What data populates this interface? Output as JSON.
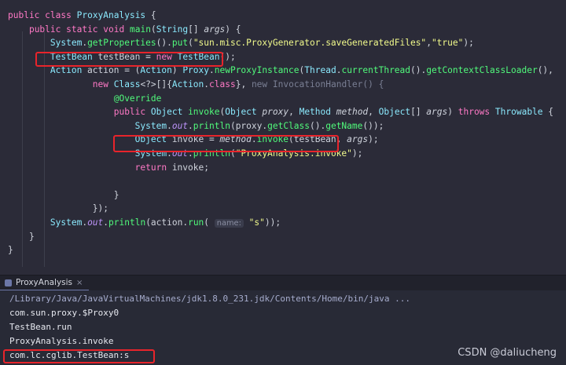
{
  "editor": {
    "lines": [
      {
        "segments": [
          {
            "t": "public",
            "c": "kw"
          },
          {
            "t": " "
          },
          {
            "t": "class",
            "c": "kw"
          },
          {
            "t": " "
          },
          {
            "t": "ProxyAnalysis",
            "c": "cls"
          },
          {
            "t": " {"
          }
        ]
      },
      {
        "segments": [
          {
            "t": "    "
          },
          {
            "t": "public",
            "c": "kw"
          },
          {
            "t": " "
          },
          {
            "t": "static",
            "c": "kw"
          },
          {
            "t": " "
          },
          {
            "t": "void",
            "c": "kw"
          },
          {
            "t": " "
          },
          {
            "t": "main",
            "c": "fn"
          },
          {
            "t": "("
          },
          {
            "t": "String",
            "c": "cls"
          },
          {
            "t": "[] "
          },
          {
            "t": "args",
            "c": "param"
          },
          {
            "t": ") {"
          }
        ]
      },
      {
        "segments": [
          {
            "t": "        "
          },
          {
            "t": "System",
            "c": "cls"
          },
          {
            "t": "."
          },
          {
            "t": "getProperties",
            "c": "fn"
          },
          {
            "t": "()."
          },
          {
            "t": "put",
            "c": "fn"
          },
          {
            "t": "("
          },
          {
            "t": "\"sun.misc.ProxyGenerator.saveGeneratedFiles\"",
            "c": "str"
          },
          {
            "t": ","
          },
          {
            "t": "\"true\"",
            "c": "str"
          },
          {
            "t": ");"
          }
        ]
      },
      {
        "segments": [
          {
            "t": "        "
          },
          {
            "t": "TestBean",
            "c": "cls"
          },
          {
            "t": " testBean = "
          },
          {
            "t": "new",
            "c": "kw"
          },
          {
            "t": " "
          },
          {
            "t": "TestBean",
            "c": "cls"
          },
          {
            "t": "();"
          }
        ]
      },
      {
        "segments": [
          {
            "t": "        "
          },
          {
            "t": "Action",
            "c": "cls"
          },
          {
            "t": " action = ("
          },
          {
            "t": "Action",
            "c": "cls"
          },
          {
            "t": ") "
          },
          {
            "t": "Proxy",
            "c": "cls"
          },
          {
            "t": "."
          },
          {
            "t": "newProxyInstance",
            "c": "fn"
          },
          {
            "t": "("
          },
          {
            "t": "Thread",
            "c": "cls"
          },
          {
            "t": "."
          },
          {
            "t": "currentThread",
            "c": "fn"
          },
          {
            "t": "()."
          },
          {
            "t": "getContextClassLoader",
            "c": "fn"
          },
          {
            "t": "(),"
          }
        ]
      },
      {
        "segments": [
          {
            "t": "                "
          },
          {
            "t": "new",
            "c": "kw"
          },
          {
            "t": " "
          },
          {
            "t": "Class",
            "c": "cls"
          },
          {
            "t": "<?>[]{"
          },
          {
            "t": "Action",
            "c": "cls"
          },
          {
            "t": "."
          },
          {
            "t": "class",
            "c": "kw"
          },
          {
            "t": "}, "
          },
          {
            "t": "new InvocationHandler() {",
            "c": "dim"
          }
        ]
      },
      {
        "segments": [
          {
            "t": "                    "
          },
          {
            "t": "@Override",
            "c": "ann"
          }
        ]
      },
      {
        "segments": [
          {
            "t": "                    "
          },
          {
            "t": "public",
            "c": "kw"
          },
          {
            "t": " "
          },
          {
            "t": "Object",
            "c": "cls"
          },
          {
            "t": " "
          },
          {
            "t": "invoke",
            "c": "fn"
          },
          {
            "t": "("
          },
          {
            "t": "Object",
            "c": "cls"
          },
          {
            "t": " "
          },
          {
            "t": "proxy",
            "c": "param"
          },
          {
            "t": ", "
          },
          {
            "t": "Method",
            "c": "cls"
          },
          {
            "t": " "
          },
          {
            "t": "method",
            "c": "param"
          },
          {
            "t": ", "
          },
          {
            "t": "Object",
            "c": "cls"
          },
          {
            "t": "[] "
          },
          {
            "t": "args",
            "c": "param"
          },
          {
            "t": ") "
          },
          {
            "t": "throws",
            "c": "kw"
          },
          {
            "t": " "
          },
          {
            "t": "Throwable",
            "c": "cls"
          },
          {
            "t": " {"
          }
        ]
      },
      {
        "segments": [
          {
            "t": "                        "
          },
          {
            "t": "System",
            "c": "cls"
          },
          {
            "t": "."
          },
          {
            "t": "out",
            "c": "field"
          },
          {
            "t": "."
          },
          {
            "t": "println",
            "c": "fn"
          },
          {
            "t": "(proxy."
          },
          {
            "t": "getClass",
            "c": "fn"
          },
          {
            "t": "()."
          },
          {
            "t": "getName",
            "c": "fn"
          },
          {
            "t": "());"
          }
        ]
      },
      {
        "segments": [
          {
            "t": "                        "
          },
          {
            "t": "Object",
            "c": "cls"
          },
          {
            "t": " invoke = "
          },
          {
            "t": "method",
            "c": "param"
          },
          {
            "t": "."
          },
          {
            "t": "invoke",
            "c": "fn"
          },
          {
            "t": "(testBean, "
          },
          {
            "t": "args",
            "c": "param"
          },
          {
            "t": ");"
          }
        ]
      },
      {
        "segments": [
          {
            "t": "                        "
          },
          {
            "t": "System",
            "c": "cls"
          },
          {
            "t": "."
          },
          {
            "t": "out",
            "c": "field"
          },
          {
            "t": "."
          },
          {
            "t": "println",
            "c": "fn"
          },
          {
            "t": "("
          },
          {
            "t": "\"ProxyAnalysis.invoke\"",
            "c": "str"
          },
          {
            "t": ");"
          }
        ]
      },
      {
        "segments": [
          {
            "t": "                        "
          },
          {
            "t": "return",
            "c": "kw"
          },
          {
            "t": " invoke;"
          }
        ]
      },
      {
        "segments": [
          {
            "t": ""
          }
        ]
      },
      {
        "segments": [
          {
            "t": "                    }"
          }
        ]
      },
      {
        "segments": [
          {
            "t": "                });"
          }
        ]
      },
      {
        "segments": [
          {
            "t": "        "
          },
          {
            "t": "System",
            "c": "cls"
          },
          {
            "t": "."
          },
          {
            "t": "out",
            "c": "field"
          },
          {
            "t": "."
          },
          {
            "t": "println",
            "c": "fn"
          },
          {
            "t": "(action."
          },
          {
            "t": "run",
            "c": "fn"
          },
          {
            "t": "( "
          },
          {
            "t": "name:",
            "c": "hint"
          },
          {
            "t": " "
          },
          {
            "t": "\"s\"",
            "c": "str"
          },
          {
            "t": "));"
          }
        ]
      },
      {
        "segments": [
          {
            "t": "    }"
          }
        ]
      },
      {
        "segments": [
          {
            "t": "}"
          }
        ]
      }
    ]
  },
  "tab": {
    "label": "ProxyAnalysis",
    "close": "×"
  },
  "console": {
    "lines": [
      "/Library/Java/JavaVirtualMachines/jdk1.8.0_231.jdk/Contents/Home/bin/java ...",
      "com.sun.proxy.$Proxy0",
      "TestBean.run",
      "ProxyAnalysis.invoke",
      "com.lc.cglib.TestBean:s"
    ]
  },
  "colors": {
    "highlight": "#e8242b",
    "background": "#2b2b38"
  },
  "watermark": "CSDN @daliucheng"
}
